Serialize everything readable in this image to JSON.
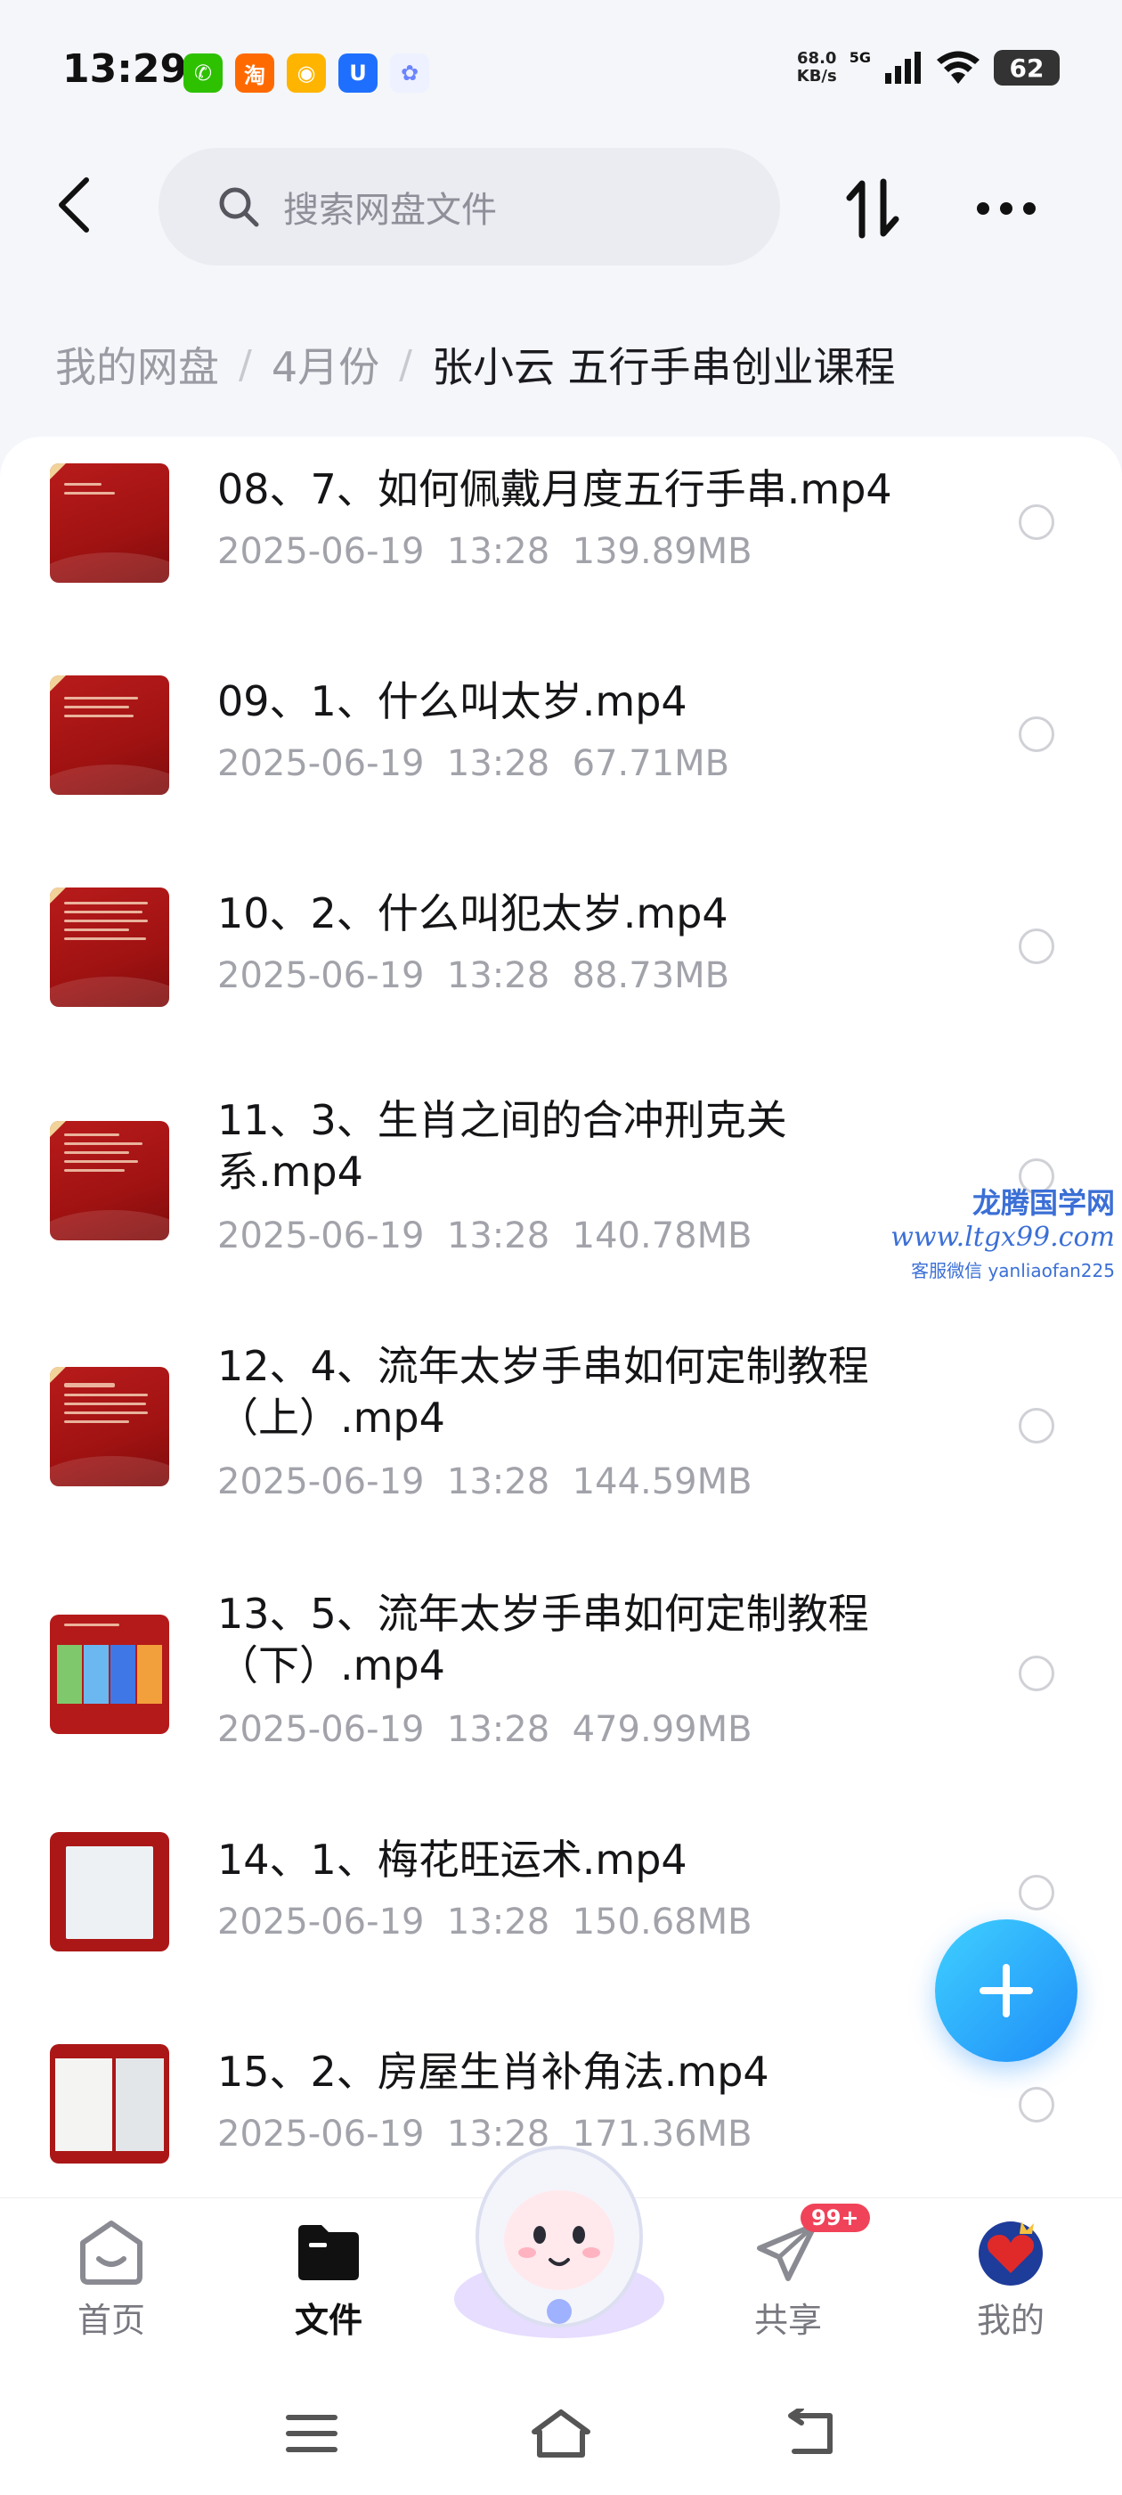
{
  "status_bar": {
    "time": "13:29",
    "app_icons": [
      {
        "name": "wechat-icon",
        "glyph": "✆",
        "color": "#2dc100"
      },
      {
        "name": "taobao-icon",
        "glyph": "淘",
        "color": "#ff6a00"
      },
      {
        "name": "reading-app-icon",
        "glyph": "◉",
        "color": "#ffb400"
      },
      {
        "name": "security-app-icon",
        "glyph": "U",
        "color": "#1f6fff"
      },
      {
        "name": "cloud-app-icon",
        "glyph": "✿",
        "color": "#a3b5ff"
      }
    ],
    "net_speed": "68.0",
    "net_unit": "KB/s",
    "signal_label": "5G",
    "battery": "62"
  },
  "header": {
    "search_placeholder": "搜索网盘文件"
  },
  "breadcrumb": [
    "我的网盘",
    "4月份",
    "张小云 五行手串创业课程"
  ],
  "files": [
    {
      "name": "08、7、如何佩戴月度五行手串.mp4",
      "date": "2025-06-19",
      "time": "13:28",
      "size": "139.89MB",
      "thumb": "slide"
    },
    {
      "name": "09、1、什么叫太岁.mp4",
      "date": "2025-06-19",
      "time": "13:28",
      "size": "67.71MB",
      "thumb": "slide"
    },
    {
      "name": "10、2、什么叫犯太岁.mp4",
      "date": "2025-06-19",
      "time": "13:28",
      "size": "88.73MB",
      "thumb": "slide"
    },
    {
      "name": "11、3、生肖之间的合冲刑克关系.mp4",
      "date": "2025-06-19",
      "time": "13:28",
      "size": "140.78MB",
      "thumb": "slide"
    },
    {
      "name": "12、4、流年太岁手串如何定制教程（上）.mp4",
      "date": "2025-06-19",
      "time": "13:28",
      "size": "144.59MB",
      "thumb": "slide"
    },
    {
      "name": "13、5、流年太岁手串如何定制教程（下）.mp4",
      "date": "2025-06-19",
      "time": "13:28",
      "size": "479.99MB",
      "thumb": "table"
    },
    {
      "name": "14、1、梅花旺运术.mp4",
      "date": "2025-06-19",
      "time": "13:28",
      "size": "150.68MB",
      "thumb": "paper"
    },
    {
      "name": "15、2、房屋生肖补角法.mp4",
      "date": "2025-06-19",
      "time": "13:28",
      "size": "171.36MB",
      "thumb": "paper"
    }
  ],
  "watermark": {
    "title": "龙腾国学网",
    "url": "www.ltgx99.com",
    "contact": "客服微信 yanliaofan225"
  },
  "bottom_nav": {
    "home": "首页",
    "files": "文件",
    "share": "共享",
    "share_badge": "99+",
    "mine": "我的"
  },
  "colors": {
    "accent": "#1e8cf8",
    "badge": "#f04359",
    "thumb_red": "#b41a1a"
  }
}
